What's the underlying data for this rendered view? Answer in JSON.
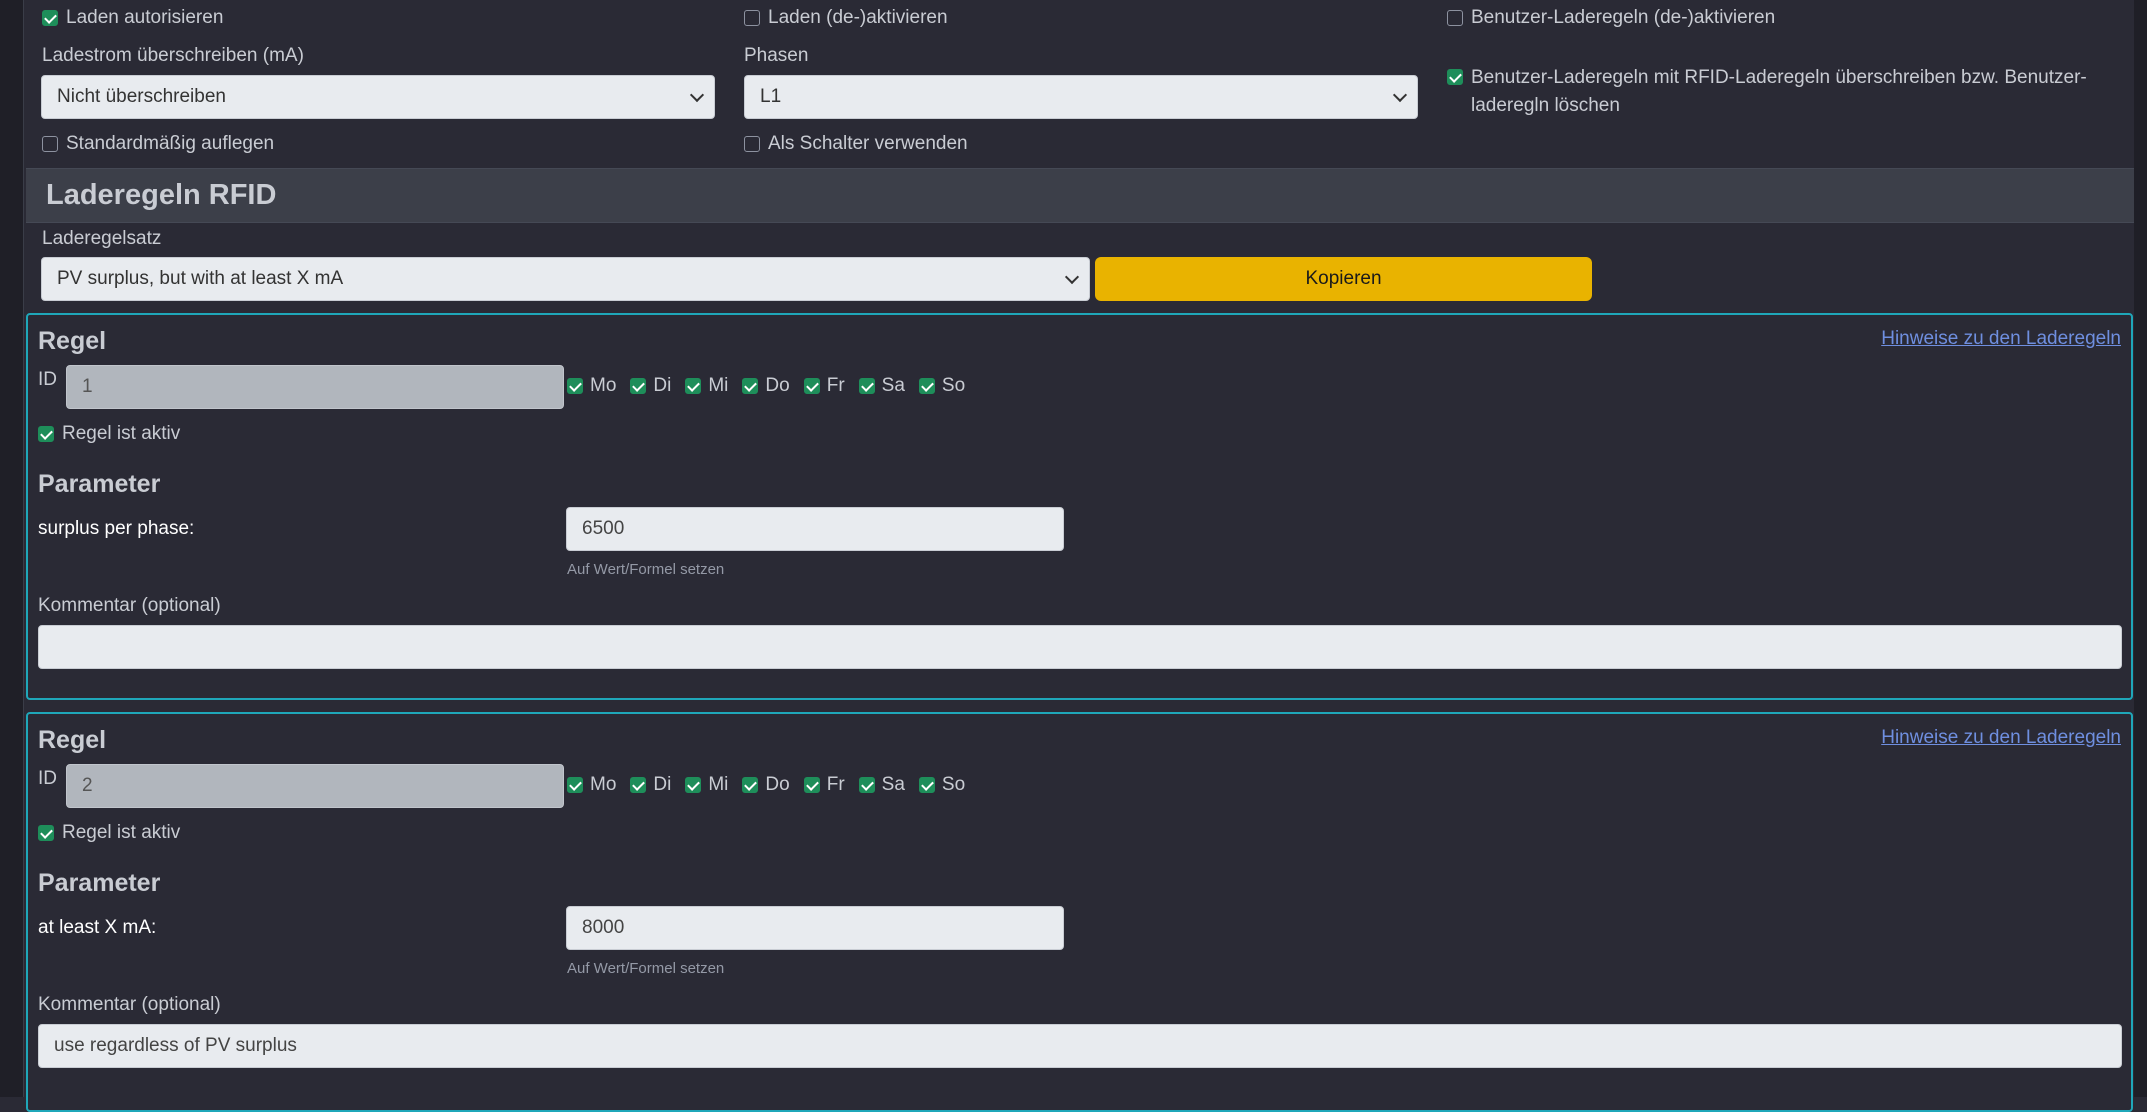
{
  "top": {
    "authorize_label": "Laden autorisieren",
    "toggle_label": "Laden (de-)aktivieren",
    "user_rules_toggle_label": "Benutzer-Laderegeln (de-)aktivieren",
    "override_current_label": "Ladestrom überschreiben (mA)",
    "override_current_value": "Nicht überschreiben",
    "phases_label": "Phasen",
    "phases_value": "L1",
    "override_user_rules_label": "Benutzer-Laderegeln mit RFID-Laderegeln überschreiben bzw. Benutzer-laderegln löschen",
    "default_hangup_label": "Standardmäßig auflegen",
    "use_as_switch_label": "Als Schalter verwenden"
  },
  "section": {
    "title": "Laderegeln RFID",
    "ruleset_label": "Laderegelsatz",
    "ruleset_value": "PV surplus, but with at least X mA",
    "copy_button": "Kopieren"
  },
  "rules": [
    {
      "title": "Regel",
      "hint_link": "Hinweise zu den Laderegeln",
      "id_label": "ID",
      "id_value": "1",
      "days": [
        "Mo",
        "Di",
        "Mi",
        "Do",
        "Fr",
        "Sa",
        "So"
      ],
      "active_label": "Regel ist aktiv",
      "param_title": "Parameter",
      "param_label": "surplus per phase:",
      "param_value": "6500",
      "param_hint": "Auf Wert/Formel setzen",
      "comment_label": "Kommentar (optional)",
      "comment_value": ""
    },
    {
      "title": "Regel",
      "hint_link": "Hinweise zu den Laderegeln",
      "id_label": "ID",
      "id_value": "2",
      "days": [
        "Mo",
        "Di",
        "Mi",
        "Do",
        "Fr",
        "Sa",
        "So"
      ],
      "active_label": "Regel ist aktiv",
      "param_title": "Parameter",
      "param_label": "at least X mA:",
      "param_value": "8000",
      "param_hint": "Auf Wert/Formel setzen",
      "comment_label": "Kommentar (optional)",
      "comment_value": "use regardless of PV surplus"
    }
  ],
  "colors": {
    "accent_border": "#1fa7b9",
    "checkbox_on": "#1e8e5a",
    "copy_button": "#e9b300",
    "link": "#6f8fe0"
  }
}
